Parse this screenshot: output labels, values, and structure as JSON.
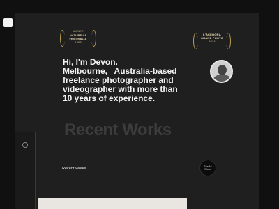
{
  "award_left": {
    "line1": "WINNER",
    "line2": "NATURE LA",
    "line3": "FESTIVALIA",
    "line4": "2023"
  },
  "award_right": {
    "line1": "L'ACEOORA",
    "line2": "GRAND PHOTO",
    "line3": "2024"
  },
  "intro": {
    "line1": "Hi, I'm Devon.",
    "line2": "Melbourne,   Australia-based",
    "line3": "freelance photographer and",
    "line4": "videographer with more than",
    "line5": "10 years of experience."
  },
  "works": {
    "heading": "Recent Works",
    "label": "Recent Works",
    "see_all": "See All Works"
  },
  "colors": {
    "background": "#101010",
    "panel": "#1f1f1f",
    "accent_gold": "#d9c08a"
  }
}
